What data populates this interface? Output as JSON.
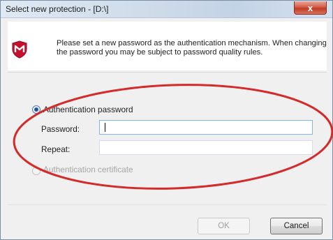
{
  "window": {
    "title": "Select new protection - [D:\\]",
    "close_label": "x"
  },
  "header": {
    "description": "Please set a new password as the authentication mechanism. When changing the password you may be subject to password quality rules."
  },
  "options": {
    "password_option_label": "Authentication password",
    "password_option_selected": true,
    "certificate_option_label": "Authentication certificate",
    "certificate_option_selected": false,
    "certificate_option_enabled": false
  },
  "fields": {
    "password_label": "Password:",
    "password_value": "",
    "repeat_label": "Repeat:",
    "repeat_value": ""
  },
  "buttons": {
    "ok_label": "OK",
    "ok_enabled": false,
    "cancel_label": "Cancel"
  },
  "colors": {
    "annotation": "#d42a2a",
    "mcafee_red": "#c8102e"
  },
  "icons": {
    "app_icon": "mcafee-shield-icon"
  }
}
